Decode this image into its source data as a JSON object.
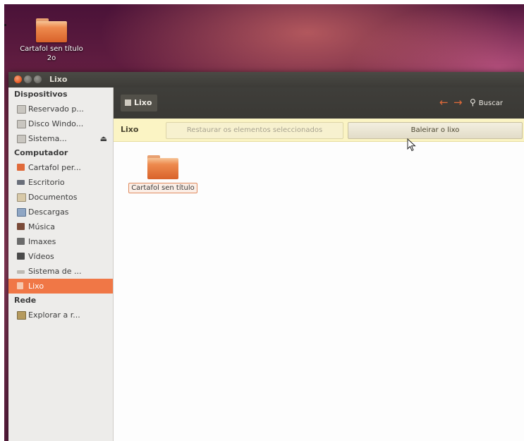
{
  "desktop": {
    "folder_label_line1": "Cartafol sen título",
    "folder_label_line2": "2o"
  },
  "window": {
    "title": "Lixo"
  },
  "sidebar": {
    "sections": [
      {
        "title": "Dispositivos"
      },
      {
        "title": "Computador"
      },
      {
        "title": "Rede"
      }
    ],
    "devices": [
      {
        "label": "Reservado p...",
        "icon": "drive-icon"
      },
      {
        "label": "Disco Windo...",
        "icon": "drive-icon"
      },
      {
        "label": "Sistema...",
        "icon": "drive-icon",
        "eject": "⏏"
      }
    ],
    "computer": [
      {
        "label": "Cartafol per...",
        "icon": "home-folder-icon"
      },
      {
        "label": "Escritorio",
        "icon": "desktop-icon"
      },
      {
        "label": "Documentos",
        "icon": "documents-icon"
      },
      {
        "label": "Descargas",
        "icon": "downloads-icon"
      },
      {
        "label": "Música",
        "icon": "music-icon"
      },
      {
        "label": "Imaxes",
        "icon": "pictures-icon"
      },
      {
        "label": "Vídeos",
        "icon": "videos-icon"
      },
      {
        "label": "Sistema de ...",
        "icon": "filesystem-icon"
      },
      {
        "label": "Lixo",
        "icon": "trash-icon",
        "active": true
      }
    ],
    "network": [
      {
        "label": "Explorar a r...",
        "icon": "network-icon"
      }
    ]
  },
  "toolbar": {
    "breadcrumb": "Lixo",
    "back_arrow": "←",
    "forward_arrow": "→",
    "search_label": "Buscar",
    "search_glyph": "⚲"
  },
  "infobar": {
    "label": "Lixo",
    "restore_button": "Restaurar os elementos seleccionados",
    "empty_button": "Baleirar o lixo"
  },
  "content": {
    "items": [
      {
        "label": "Cartafol sen título",
        "type": "folder"
      }
    ]
  },
  "colors": {
    "accent": "#f07746",
    "titlebar": "#3c3b37",
    "infobar": "#fbf4c4",
    "folder": "#ee8a4e"
  }
}
